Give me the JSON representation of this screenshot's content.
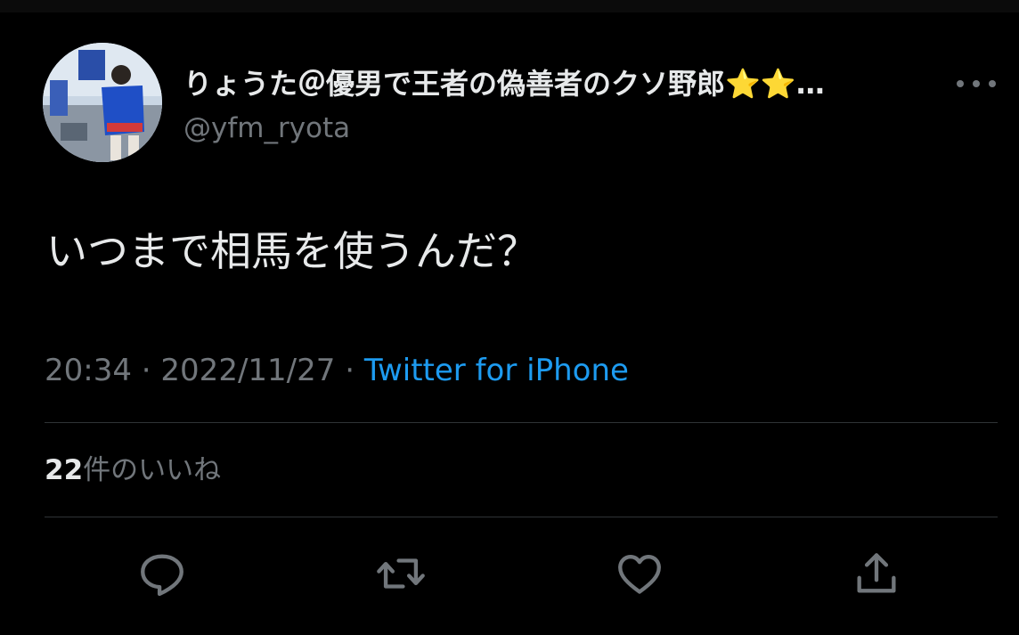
{
  "author": {
    "display_name": "りょうた＠優男で王者の偽善者のクソ野郎⭐️⭐️…",
    "handle": "@yfm_ryota",
    "avatar_icon": "user-avatar"
  },
  "tweet": {
    "text": "いつまで相馬を使うんだ？"
  },
  "meta": {
    "time": "20:34",
    "separator": "·",
    "date": "2022/11/27",
    "source": "Twitter for iPhone"
  },
  "stats": {
    "likes_count": "22",
    "likes_label": "件のいいね"
  },
  "actions": {
    "reply_icon": "reply-icon",
    "retweet_icon": "retweet-icon",
    "like_icon": "heart-icon",
    "share_icon": "share-icon"
  },
  "colors": {
    "background": "#000000",
    "text": "#e7e9ea",
    "secondary": "#71767b",
    "accent": "#1d9bf0",
    "divider": "#2f3336"
  }
}
